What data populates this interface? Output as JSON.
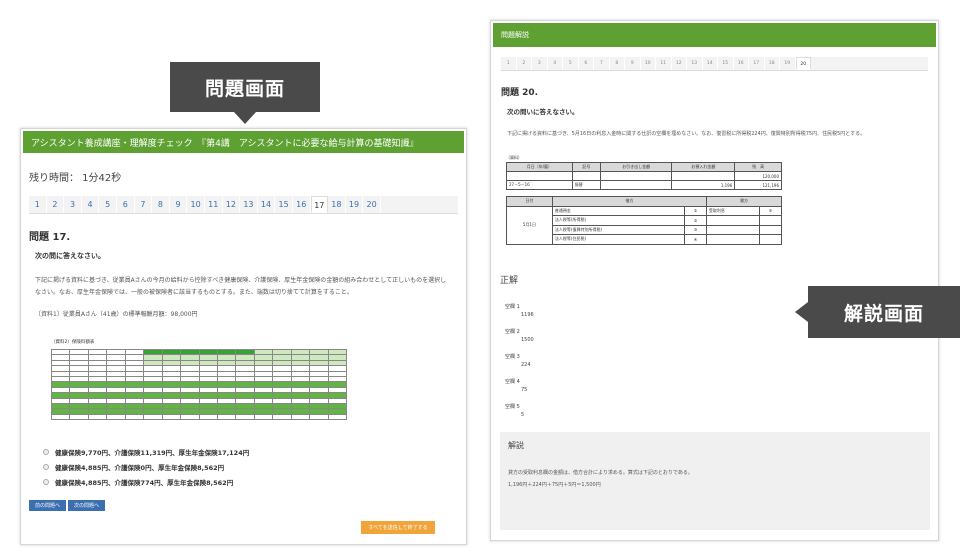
{
  "callouts": {
    "question_screen": "問題画面",
    "explanation_screen": "解説画面"
  },
  "question_panel": {
    "header": "アシスタント養成講座・理解度チェック　『第4講　アシスタントに必要な給与計算の基礎知識』",
    "timer": "残り時間：  1分42秒",
    "tabs": [
      "1",
      "2",
      "3",
      "4",
      "5",
      "6",
      "7",
      "8",
      "9",
      "10",
      "11",
      "12",
      "13",
      "14",
      "15",
      "16",
      "17",
      "18",
      "19",
      "20"
    ],
    "active_tab": "17",
    "title": "問題 17.",
    "instruction": "次の問に答えなさい。",
    "text": "下記に掲げる資料に基づき、従業員Aさんの今月の給料から控除すべき健康保険、介護保険、厚生年金保険の金額の組み合わせとして正しいものを選択しなさい。なお、厚生年金保険では、一般の被保険者に該当するものとする。また、端数は切り捨てて計算をすること。",
    "data_line": "〔資料1〕従業員Aさん（41歳）の標準報酬月額：98,000円",
    "table_caption": "（資料2）保険料額表",
    "options": [
      "健康保険9,770円、介護保険11,319円、厚生年金保険17,124円",
      "健康保険4,885円、介護保険0円、厚生年金保険8,562円",
      "健康保険4,885円、介護保険774円、厚生年金保険8,562円"
    ],
    "prev_button": "前の問題へ",
    "next_button": "次の問題へ",
    "finish_button": "すべてを送信して終了する"
  },
  "answer_panel": {
    "header": "問題解説",
    "tabs": [
      "1",
      "2",
      "3",
      "4",
      "5",
      "6",
      "7",
      "8",
      "9",
      "10",
      "11",
      "12",
      "13",
      "14",
      "15",
      "16",
      "17",
      "18",
      "19",
      "20"
    ],
    "active_tab": "20",
    "title": "問題 20.",
    "instruction": "次の問いに答えなさい。",
    "text": "下記に掲げる資料に基づき、5月16日の利息入金時に関する仕訳の空欄を埋めなさい。なお、復習税に所得税224円、復興特別所得税75円、住民税5円とする。",
    "journal_caption": "（資料）",
    "journal_headers": [
      "月日（年/暦）",
      "記号",
      "お引き出し金額",
      "お預入れ金額",
      "残　高"
    ],
    "journal_rows": [
      [
        "",
        "",
        "",
        "",
        "120,000"
      ],
      [
        "27－5－16",
        "振替",
        "",
        "1,196",
        "121,196"
      ]
    ],
    "entry_headers": [
      "日付",
      "借方",
      "",
      "貸方",
      ""
    ],
    "entry_date": "5月1日",
    "entry_debits": [
      "普通預金",
      "法人税等(所得税)",
      "法人税等(復興特別所得税)",
      "法人税等(住民税)"
    ],
    "entry_debit_marks": [
      "①",
      "②",
      "③",
      "④"
    ],
    "entry_credit": "受取利息",
    "entry_credit_mark": "⑤",
    "answer_title": "正解",
    "blanks": [
      {
        "label": "空欄 1",
        "value": "1196"
      },
      {
        "label": "空欄 2",
        "value": "1500"
      },
      {
        "label": "空欄 3",
        "value": "224"
      },
      {
        "label": "空欄 4",
        "value": "75"
      },
      {
        "label": "空欄 5",
        "value": "5"
      }
    ],
    "explanation_title": "解説",
    "explanation_text_1": "貸方の受取利息欄の金額は、借方合計により求める。算式は下記のとおりである。",
    "explanation_text_2": "1,196円＋224円＋75円＋5円＝1,500円"
  }
}
